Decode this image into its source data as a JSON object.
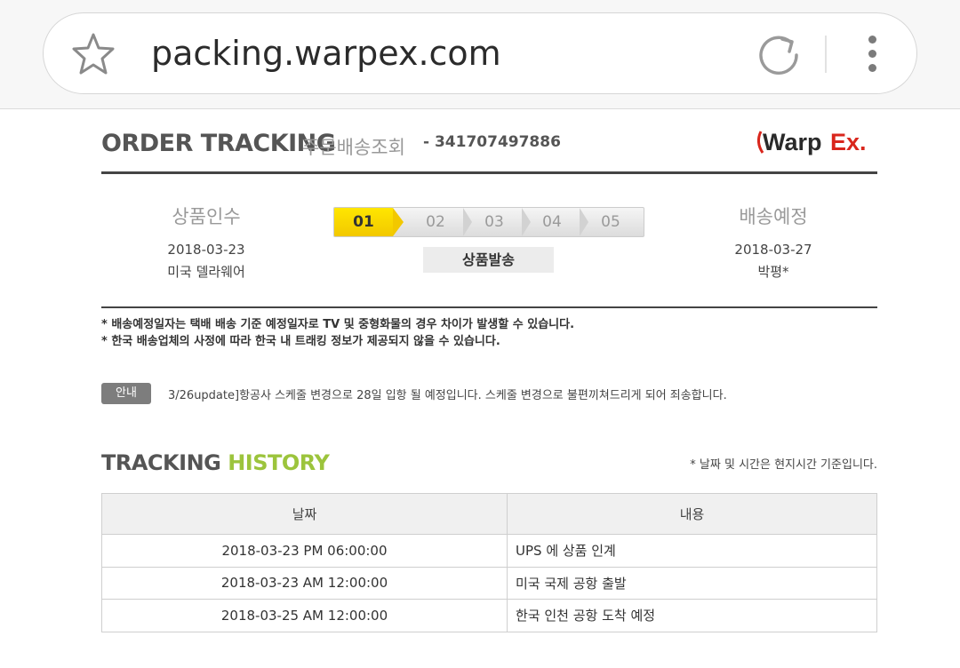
{
  "browser": {
    "url": "packing.warpex.com"
  },
  "header": {
    "title": "ORDER TRACKING",
    "title_kr": "주문배송조회",
    "order_number": "- 341707497886",
    "logo_text": "WarpEx."
  },
  "shipment": {
    "origin_label": "상품인수",
    "origin_date": "2018-03-23",
    "origin_place": "미국 델라웨어",
    "dest_label": "배송예정",
    "dest_date": "2018-03-27",
    "dest_place": "박평*",
    "steps": [
      "01",
      "02",
      "03",
      "04",
      "05"
    ],
    "active_step": 1,
    "status_label": "상품발송"
  },
  "notes": [
    "* 배송예정일자는 택배 배송 기준 예정일자로 TV 및 중형화물의 경우 차이가 발생할 수 있습니다.",
    "* 한국 배송업체의 사정에 따라 한국 내 트래킹 정보가 제공되지 않을 수 있습니다."
  ],
  "notice": {
    "badge": "안내",
    "text": "3/26update]항공사 스케줄 변경으로 28일 입항 될 예정입니다. 스케줄 변경으로 불편끼쳐드리게 되어 죄송합니다."
  },
  "history": {
    "title_a": "TRACKING ",
    "title_b": "HISTORY",
    "note": "* 날짜 및 시간은 현지시간 기준입니다.",
    "col_date": "날짜",
    "col_content": "내용",
    "rows": [
      {
        "date": "2018-03-23 PM 06:00:00",
        "content": "UPS 에 상품 인계"
      },
      {
        "date": "2018-03-23 AM 12:00:00",
        "content": "미국 국제 공항 출발"
      },
      {
        "date": "2018-03-25 AM 12:00:00",
        "content": "한국 인천 공항 도착 예정"
      }
    ]
  },
  "colors": {
    "active_step": "#ffe600",
    "history_accent": "#9cc43c",
    "logo_red": "#d9261c"
  }
}
